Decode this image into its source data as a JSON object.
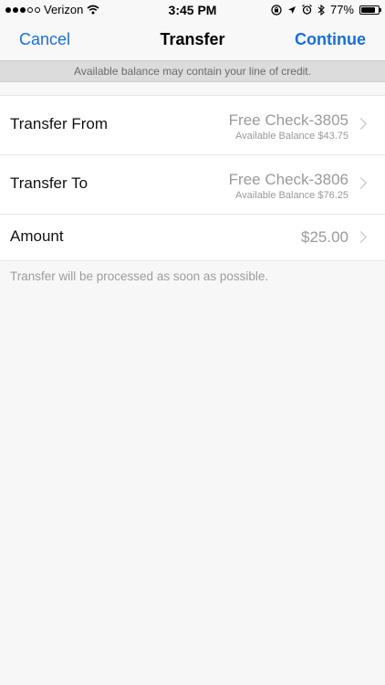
{
  "status_bar": {
    "carrier": "Verizon",
    "time": "3:45 PM",
    "battery_percent": "77%",
    "signal_dots_filled": 3,
    "signal_dots_total": 5,
    "icons": [
      "signal-dots-icon",
      "wifi-icon",
      "orientation-lock-icon",
      "location-arrow-icon",
      "alarm-icon",
      "bluetooth-icon",
      "battery-icon"
    ]
  },
  "navbar": {
    "cancel_label": "Cancel",
    "title": "Transfer",
    "continue_label": "Continue",
    "accent_color": "#1c6ed6"
  },
  "banner": {
    "text": "Available balance may contain your line of credit."
  },
  "rows": [
    {
      "label": "Transfer From",
      "value": "Free Check-3805",
      "sub": "Available Balance $43.75"
    },
    {
      "label": "Transfer To",
      "value": "Free Check-3806",
      "sub": "Available Balance $76.25"
    },
    {
      "label": "Amount",
      "value": "$25.00"
    }
  ],
  "footnote": "Transfer will be processed as soon as possible."
}
